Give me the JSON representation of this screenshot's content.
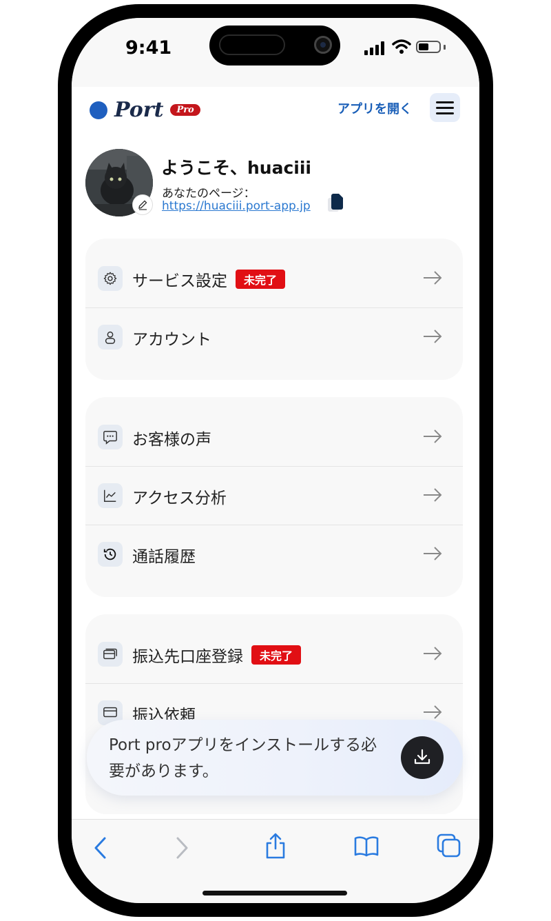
{
  "status_bar": {
    "time": "9:41"
  },
  "header": {
    "logo_text": "Port",
    "logo_badge": "Pro",
    "open_app_label": "アプリを開く",
    "menu_icon": "hamburger-icon"
  },
  "profile": {
    "welcome": "ようこそ、huaciii",
    "your_page_label": "あなたのページ：",
    "url": "https://huaciii.port-app.jp"
  },
  "sections": [
    {
      "items": [
        {
          "icon": "gear-icon",
          "label": "サービス設定",
          "badge": "未完了"
        },
        {
          "icon": "person-icon",
          "label": "アカウント"
        }
      ]
    },
    {
      "items": [
        {
          "icon": "chat-bubble-icon",
          "label": "お客様の声"
        },
        {
          "icon": "line-chart-icon",
          "label": "アクセス分析"
        },
        {
          "icon": "history-icon",
          "label": "通話履歴"
        }
      ]
    },
    {
      "items": [
        {
          "icon": "bank-card-icon",
          "label": "振込先口座登録",
          "badge": "未完了"
        },
        {
          "icon": "transfer-request-icon",
          "label": "振込依頼"
        }
      ]
    }
  ],
  "install_banner": {
    "text": "Port proアプリをインストールする必要があります。",
    "button_icon": "download-icon"
  },
  "colors": {
    "accent_blue": "#1a5fb8",
    "badge_red": "#e10f14",
    "logo_badge_red": "#c4161c"
  },
  "toolbar": {
    "icons": [
      "back-icon",
      "forward-icon",
      "share-icon",
      "bookmarks-icon",
      "tabs-icon"
    ]
  }
}
